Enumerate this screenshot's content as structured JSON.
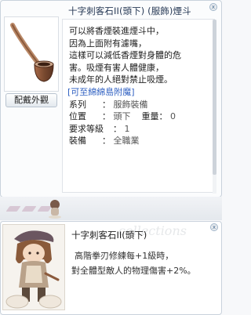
{
  "item_window": {
    "title": "十字刺客石II(頭下) (服飾)煙斗",
    "outfit_button": "配戴外觀",
    "description": [
      "可以將香煙裝進煙斗中，",
      "因為上面附有濾嘴，",
      "這樣可以減低香煙對身體的危",
      "害。吸煙有害人體健康，",
      "未成年的人絕對禁止吸煙。"
    ],
    "link_text": "[可至綿綿島附魔]",
    "stats": {
      "series_label": "系列",
      "series_value": "服飾裝備",
      "position_label": "位置",
      "position_value": "頭下",
      "weight_label": "重量",
      "weight_value": "0",
      "level_label": "要求等級",
      "level_value": "1",
      "equip_label": "裝備",
      "equip_value": "全職業"
    }
  },
  "card_window": {
    "title": "十字刺客石II(頭下)",
    "lines": [
      "高階拳刃修練每+1級時，",
      "對全體型敵人的物理傷害+2%。"
    ],
    "watermark": "collections"
  },
  "colors": {
    "title_text": "#283a56",
    "link": "#2e5fc1",
    "pipe": "#8b5a3c"
  }
}
